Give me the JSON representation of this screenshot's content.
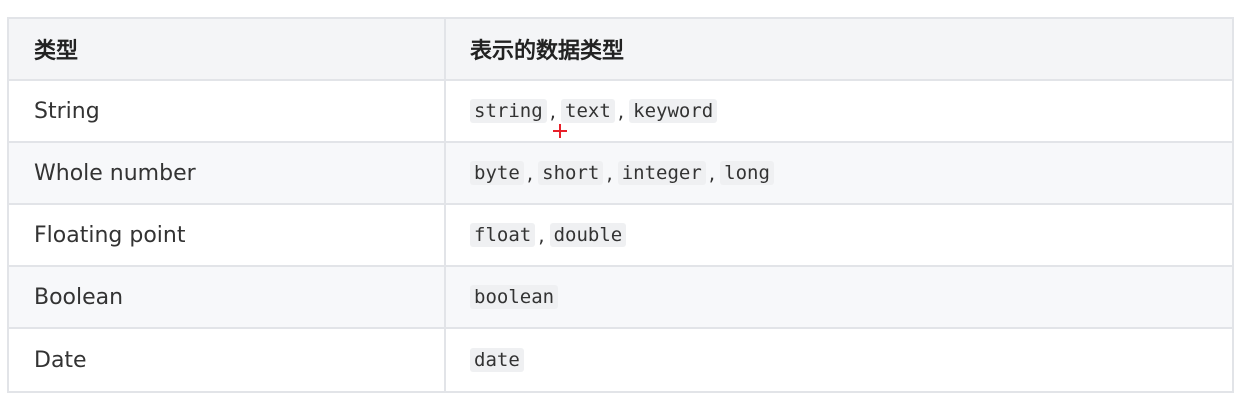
{
  "table": {
    "headers": [
      "类型",
      "表示的数据类型"
    ],
    "rows": [
      {
        "type": "String",
        "codes": [
          "string",
          "text",
          "keyword"
        ]
      },
      {
        "type": "Whole number",
        "codes": [
          "byte",
          "short",
          "integer",
          "long"
        ]
      },
      {
        "type": "Floating point",
        "codes": [
          "float",
          "double"
        ]
      },
      {
        "type": "Boolean",
        "codes": [
          "boolean"
        ]
      },
      {
        "type": "Date",
        "codes": [
          "date"
        ]
      }
    ],
    "separator": ","
  },
  "colors": {
    "border": "#e2e4e8",
    "header_bg": "#f4f5f7",
    "code_bg": "#eff0f2",
    "cursor": "#e8202a"
  },
  "icons": {
    "cursor": "crosshair-cursor-icon"
  }
}
